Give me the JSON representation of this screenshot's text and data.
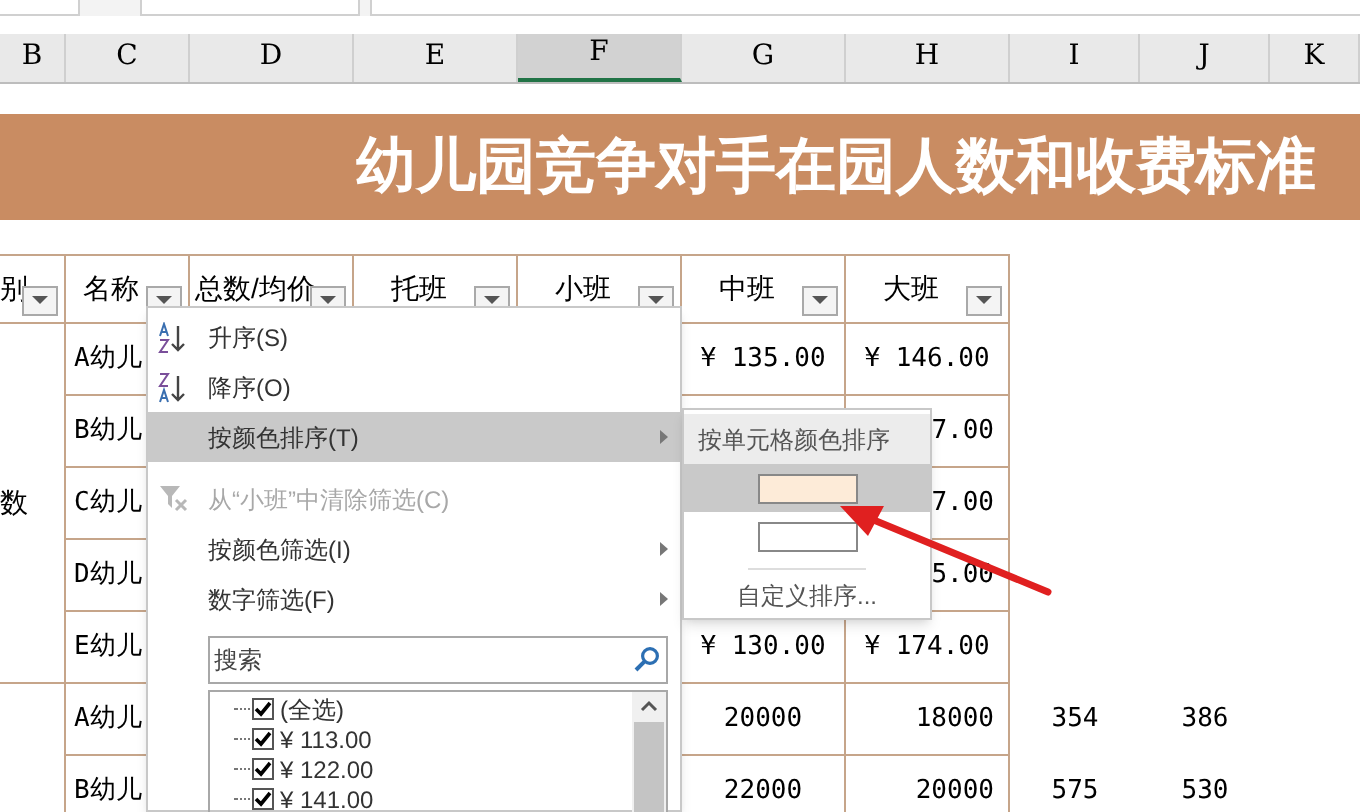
{
  "columns": [
    {
      "letter": "B",
      "selected": false
    },
    {
      "letter": "C",
      "selected": false
    },
    {
      "letter": "D",
      "selected": false
    },
    {
      "letter": "E",
      "selected": false
    },
    {
      "letter": "F",
      "selected": true
    },
    {
      "letter": "G",
      "selected": false
    },
    {
      "letter": "H",
      "selected": false
    },
    {
      "letter": "I",
      "selected": false
    },
    {
      "letter": "J",
      "selected": false
    },
    {
      "letter": "K",
      "selected": false
    }
  ],
  "title": "幼儿园竞争对手在园人数和收费标准",
  "headers": [
    "别",
    "名称",
    "总数/均价",
    "托班",
    "小班",
    "中班",
    "大班"
  ],
  "groups": [
    {
      "label": "数",
      "rows": [
        {
          "name": "A幼儿",
          "g": "¥  135.00",
          "h": "¥  146.00"
        },
        {
          "name": "B幼儿",
          "h": "7.00"
        },
        {
          "name": "C幼儿",
          "h": "7.00"
        },
        {
          "name": "D幼儿",
          "h": "5.00"
        },
        {
          "name": "E幼儿",
          "g": "¥  130.00",
          "h": "¥  174.00"
        }
      ]
    },
    {
      "rows": [
        {
          "name": "A幼儿",
          "g": "20000",
          "h": "18000",
          "i": "354",
          "j": "386"
        },
        {
          "name": "B幼儿",
          "g": "22000",
          "h": "20000",
          "i": "575",
          "j": "530"
        }
      ]
    }
  ],
  "menu": {
    "items": [
      {
        "kind": "sort-asc",
        "label": "升序(S)",
        "selected": false,
        "disabled": false,
        "has_submenu": false
      },
      {
        "kind": "sort-desc",
        "label": "降序(O)",
        "selected": false,
        "disabled": false,
        "has_submenu": false
      },
      {
        "kind": "plain",
        "label": "按颜色排序(T)",
        "selected": true,
        "disabled": false,
        "has_submenu": true
      },
      {
        "kind": "clear-filter",
        "label": "从“小班”中清除筛选(C)",
        "selected": false,
        "disabled": true,
        "has_submenu": false
      },
      {
        "kind": "plain",
        "label": "按颜色筛选(I)",
        "selected": false,
        "disabled": false,
        "has_submenu": true
      },
      {
        "kind": "plain",
        "label": "数字筛选(F)",
        "selected": false,
        "disabled": false,
        "has_submenu": true
      }
    ],
    "search": {
      "placeholder": "搜索"
    },
    "values": [
      {
        "label": "(全选)",
        "checked": true
      },
      {
        "label": "¥ 113.00",
        "checked": true
      },
      {
        "label": "¥ 122.00",
        "checked": true
      },
      {
        "label": "¥ 141.00",
        "checked": true
      }
    ]
  },
  "submenu": {
    "header": "按单元格颜色排序",
    "swatches": [
      {
        "color": "#fdebd8",
        "selected": true
      },
      {
        "color": "#ffffff",
        "selected": false
      }
    ],
    "custom": "自定义排序..."
  }
}
